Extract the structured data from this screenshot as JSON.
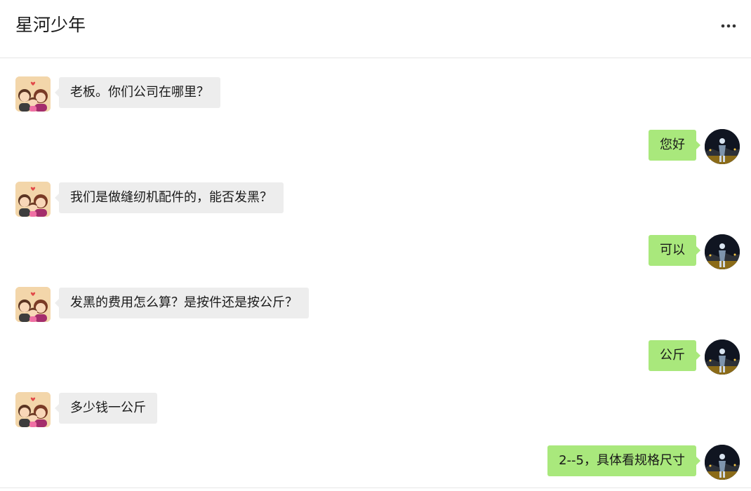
{
  "header": {
    "title": "星河少年",
    "more_icon": "more-icon"
  },
  "colors": {
    "incoming_bubble": "#ededed",
    "outgoing_bubble": "#a9e87c",
    "divider": "#e6e6e6"
  },
  "messages": [
    {
      "side": "left",
      "text": "老板。你们公司在哪里？",
      "avatar": "family-avatar"
    },
    {
      "side": "right",
      "text": "您好",
      "avatar": "night-person-avatar"
    },
    {
      "side": "left",
      "text": "我们是做缝纫机配件的，能否发黑？",
      "avatar": "family-avatar"
    },
    {
      "side": "right",
      "text": "可以",
      "avatar": "night-person-avatar"
    },
    {
      "side": "left",
      "text": "发黑的费用怎么算？是按件还是按公斤？",
      "avatar": "family-avatar"
    },
    {
      "side": "right",
      "text": "公斤",
      "avatar": "night-person-avatar"
    },
    {
      "side": "left",
      "text": "多少钱一公斤",
      "avatar": "family-avatar"
    },
    {
      "side": "right",
      "text": "2--5，具体看规格尺寸",
      "avatar": "night-person-avatar"
    }
  ]
}
